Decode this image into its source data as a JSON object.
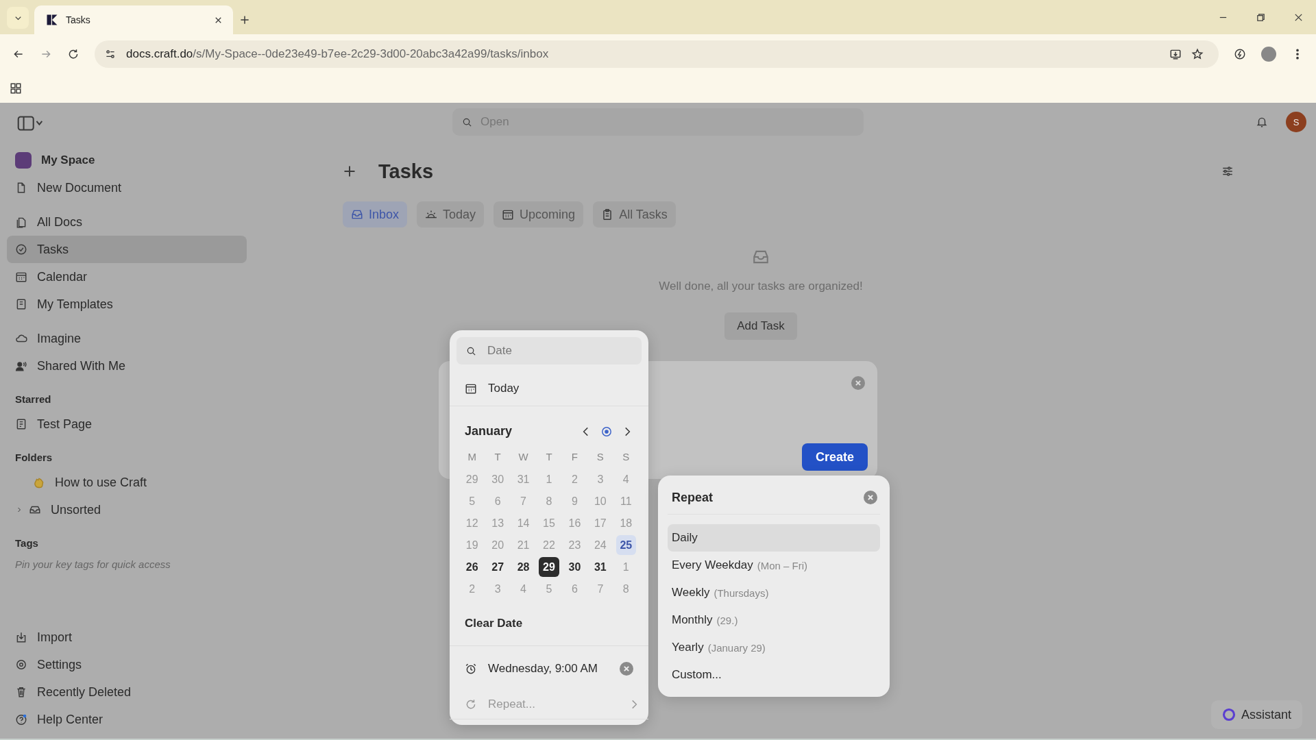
{
  "browser": {
    "tab_title": "Tasks",
    "url_host": "docs.craft.do",
    "url_path": "/s/My-Space--0de23e49-b7ee-2c29-3d00-20abc3a42a99/tasks/inbox"
  },
  "topbar": {
    "search_placeholder": "Open",
    "avatar": "S"
  },
  "sidebar": {
    "workspace": "My Space",
    "items": [
      {
        "label": "New Document",
        "selected": false
      }
    ],
    "nav": [
      {
        "label": "All Docs",
        "selected": false
      },
      {
        "label": "Tasks",
        "selected": true
      },
      {
        "label": "Calendar",
        "selected": false
      },
      {
        "label": "My Templates",
        "selected": false
      }
    ],
    "more": [
      {
        "label": "Imagine",
        "selected": false
      },
      {
        "label": "Shared With Me",
        "selected": false
      }
    ],
    "starred": {
      "title": "Starred",
      "items": [
        {
          "label": "Test Page",
          "selected": false
        }
      ]
    },
    "folders": {
      "title": "Folders",
      "items": [
        {
          "label": "How to use Craft",
          "kind": "emoji"
        },
        {
          "label": "Unsorted",
          "kind": "folder"
        }
      ]
    },
    "tags": {
      "title": "Tags",
      "hint": "Pin your key tags for quick access"
    },
    "bottom": [
      {
        "label": "Import",
        "selected": false
      },
      {
        "label": "Settings",
        "selected": false
      },
      {
        "label": "Recently Deleted",
        "selected": false
      },
      {
        "label": "Help Center",
        "selected": false
      }
    ]
  },
  "page": {
    "title": "Tasks",
    "tabs": [
      {
        "label": "Inbox",
        "selected": true
      },
      {
        "label": "Today",
        "selected": false
      },
      {
        "label": "Upcoming",
        "selected": false
      },
      {
        "label": "All Tasks",
        "selected": false
      }
    ],
    "empty_message": "Well done, all your tasks are organized!",
    "add_task": "Add Task",
    "create": "Create"
  },
  "date_popup": {
    "placeholder": "Date",
    "today": "Today",
    "month": "January",
    "weekdays": [
      "M",
      "T",
      "W",
      "T",
      "F",
      "S",
      "S"
    ],
    "weeks": [
      [
        {
          "day": "29",
          "muted": true,
          "today": false,
          "selected": false
        },
        {
          "day": "30",
          "muted": true,
          "today": false,
          "selected": false
        },
        {
          "day": "31",
          "muted": true,
          "today": false,
          "selected": false
        },
        {
          "day": "1",
          "muted": true,
          "today": false,
          "selected": false
        },
        {
          "day": "2",
          "muted": true,
          "today": false,
          "selected": false
        },
        {
          "day": "3",
          "muted": true,
          "today": false,
          "selected": false
        },
        {
          "day": "4",
          "muted": true,
          "today": false,
          "selected": false
        }
      ],
      [
        {
          "day": "5",
          "muted": true,
          "today": false,
          "selected": false
        },
        {
          "day": "6",
          "muted": true,
          "today": false,
          "selected": false
        },
        {
          "day": "7",
          "muted": true,
          "today": false,
          "selected": false
        },
        {
          "day": "8",
          "muted": true,
          "today": false,
          "selected": false
        },
        {
          "day": "9",
          "muted": true,
          "today": false,
          "selected": false
        },
        {
          "day": "10",
          "muted": true,
          "today": false,
          "selected": false
        },
        {
          "day": "11",
          "muted": true,
          "today": false,
          "selected": false
        }
      ],
      [
        {
          "day": "12",
          "muted": true,
          "today": false,
          "selected": false
        },
        {
          "day": "13",
          "muted": true,
          "today": false,
          "selected": false
        },
        {
          "day": "14",
          "muted": true,
          "today": false,
          "selected": false
        },
        {
          "day": "15",
          "muted": true,
          "today": false,
          "selected": false
        },
        {
          "day": "16",
          "muted": true,
          "today": false,
          "selected": false
        },
        {
          "day": "17",
          "muted": true,
          "today": false,
          "selected": false
        },
        {
          "day": "18",
          "muted": true,
          "today": false,
          "selected": false
        }
      ],
      [
        {
          "day": "19",
          "muted": true,
          "today": false,
          "selected": false
        },
        {
          "day": "20",
          "muted": true,
          "today": false,
          "selected": false
        },
        {
          "day": "21",
          "muted": true,
          "today": false,
          "selected": false
        },
        {
          "day": "22",
          "muted": true,
          "today": false,
          "selected": false
        },
        {
          "day": "23",
          "muted": true,
          "today": false,
          "selected": false
        },
        {
          "day": "24",
          "muted": true,
          "today": false,
          "selected": false
        },
        {
          "day": "25",
          "muted": false,
          "today": true,
          "selected": false
        }
      ],
      [
        {
          "day": "26",
          "muted": false,
          "today": false,
          "selected": false
        },
        {
          "day": "27",
          "muted": false,
          "today": false,
          "selected": false
        },
        {
          "day": "28",
          "muted": false,
          "today": false,
          "selected": false
        },
        {
          "day": "29",
          "muted": false,
          "today": false,
          "selected": true
        },
        {
          "day": "30",
          "muted": false,
          "today": false,
          "selected": false
        },
        {
          "day": "31",
          "muted": false,
          "today": false,
          "selected": false
        },
        {
          "day": "1",
          "muted": true,
          "today": false,
          "selected": false
        }
      ],
      [
        {
          "day": "2",
          "muted": true,
          "today": false,
          "selected": false
        },
        {
          "day": "3",
          "muted": true,
          "today": false,
          "selected": false
        },
        {
          "day": "4",
          "muted": true,
          "today": false,
          "selected": false
        },
        {
          "day": "5",
          "muted": true,
          "today": false,
          "selected": false
        },
        {
          "day": "6",
          "muted": true,
          "today": false,
          "selected": false
        },
        {
          "day": "7",
          "muted": true,
          "today": false,
          "selected": false
        },
        {
          "day": "8",
          "muted": true,
          "today": false,
          "selected": false
        }
      ]
    ],
    "clear": "Clear Date",
    "time": "Wednesday, 9:00 AM",
    "repeat": "Repeat..."
  },
  "repeat_popup": {
    "title": "Repeat",
    "options": [
      {
        "label": "Daily",
        "hovered": true
      },
      {
        "label": "Every Weekday",
        "hint": "(Mon – Fri)",
        "hovered": false
      },
      {
        "label": "Weekly",
        "hint": "(Thursdays)",
        "hovered": false
      },
      {
        "label": "Monthly",
        "hint": "(29.)",
        "hovered": false
      },
      {
        "label": "Yearly",
        "hint": "(January 29)",
        "hovered": false
      },
      {
        "label": "Custom...",
        "hovered": false
      }
    ]
  },
  "assistant": "Assistant"
}
